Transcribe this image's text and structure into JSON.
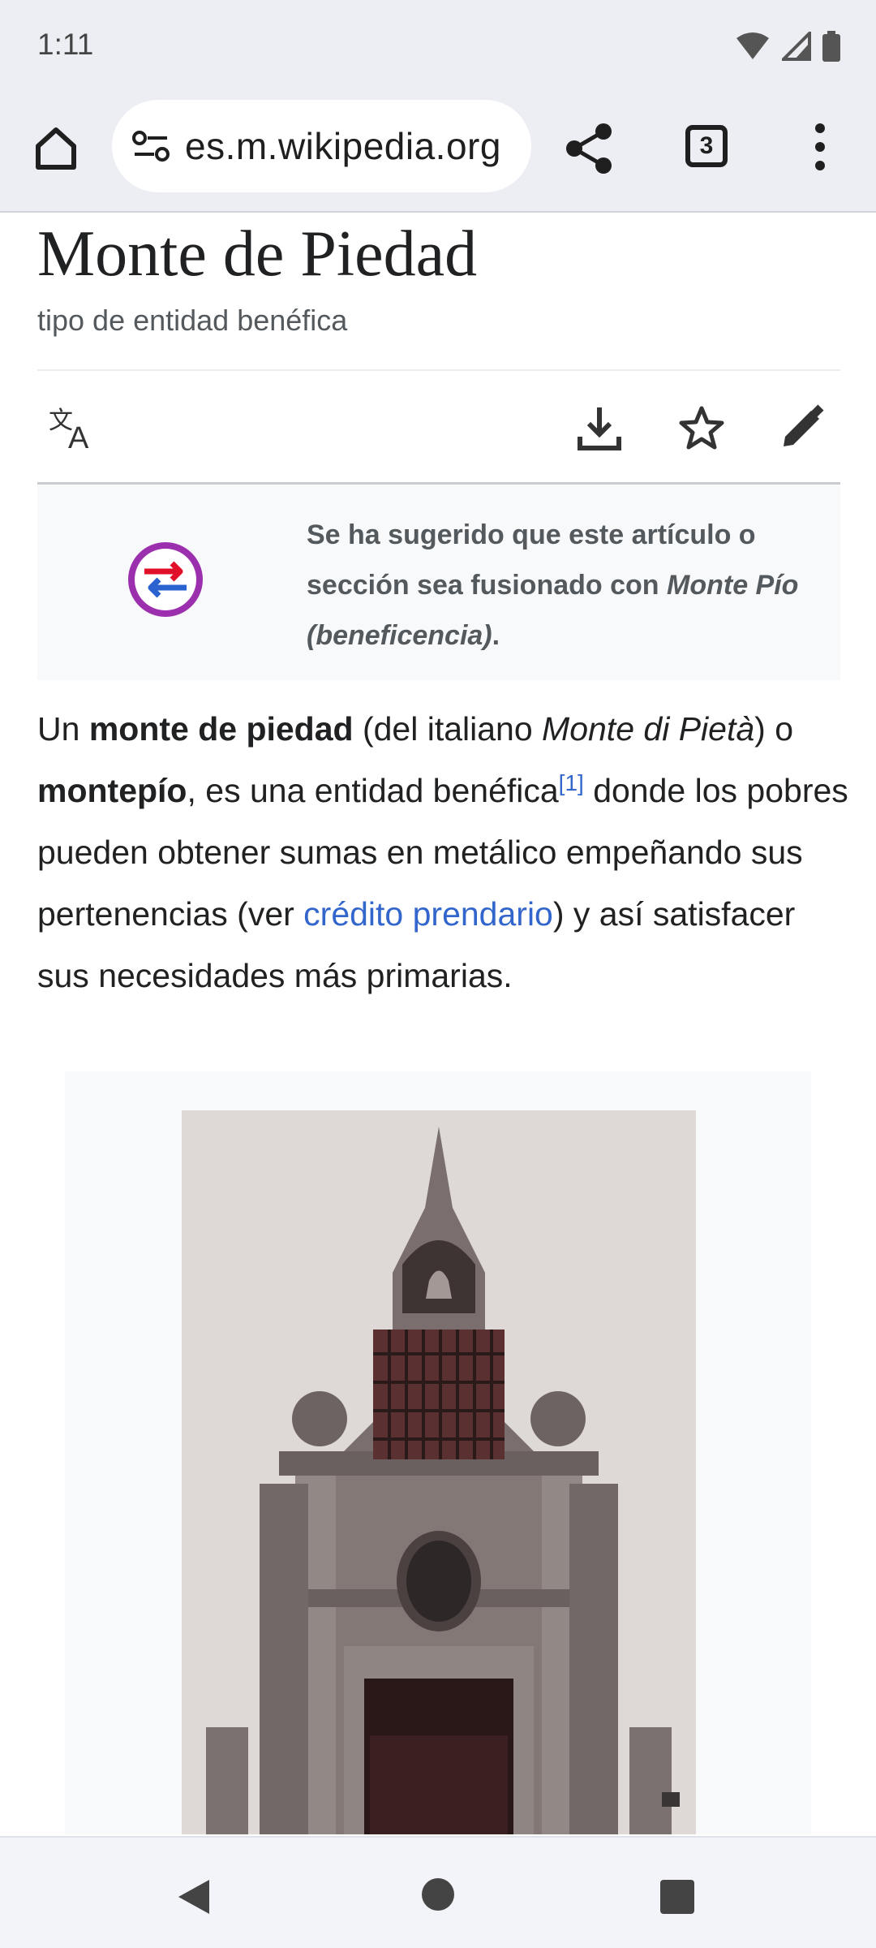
{
  "status": {
    "time": "1:11"
  },
  "browser": {
    "url": "es.m.wikipedia.org",
    "tab_count": "3"
  },
  "article": {
    "title": "Monte de Piedad",
    "subtitle": "tipo de entidad benéfica",
    "notice": {
      "prefix": "Se ha sugerido que este artículo o sección sea fusionado con ",
      "link": "Monte Pío (beneficencia)",
      "suffix": "."
    },
    "intro": {
      "p1": "Un ",
      "b1": "monte de piedad",
      "p2": " (del italiano ",
      "i1": "Monte di Pietà",
      "p3": ") o ",
      "b2": "montepío",
      "p4": ", es una entidad benéfica",
      "ref": "[1]",
      "p5": "  donde los pobres pueden obtener sumas en metálico empeñando sus pertenencias (ver ",
      "link1": "crédito prendario",
      "p6": ") y así satisfacer sus necesidades más primarias."
    }
  },
  "colors": {
    "link": "#3366cc",
    "text": "#202122",
    "chrome_bg": "#eceef3"
  }
}
